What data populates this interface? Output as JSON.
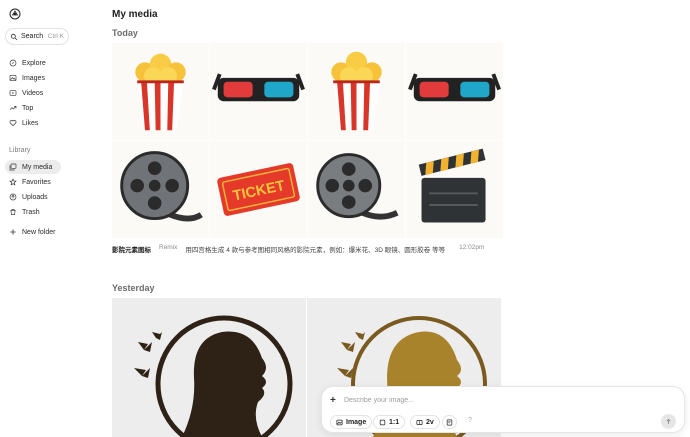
{
  "sidebar": {
    "search": {
      "label": "Search",
      "shortcut": "Ctrl K"
    },
    "nav": [
      {
        "label": "Explore",
        "icon": "compass-icon"
      },
      {
        "label": "Images",
        "icon": "image-icon"
      },
      {
        "label": "Videos",
        "icon": "video-icon"
      },
      {
        "label": "Top",
        "icon": "trending-icon"
      },
      {
        "label": "Likes",
        "icon": "heart-icon"
      }
    ],
    "library_label": "Library",
    "library": [
      {
        "label": "My media",
        "icon": "media-icon",
        "active": true
      },
      {
        "label": "Favorites",
        "icon": "star-icon"
      },
      {
        "label": "Uploads",
        "icon": "upload-icon"
      },
      {
        "label": "Trash",
        "icon": "trash-icon"
      }
    ],
    "new_folder": "New folder"
  },
  "main": {
    "title": "My media",
    "groups": [
      {
        "label": "Today",
        "images": [
          "popcorn",
          "3d-glasses",
          "popcorn",
          "3d-glasses",
          "film-reel",
          "ticket",
          "film-reel",
          "clapperboard"
        ],
        "ticket_text": "TICKET",
        "caption": {
          "title": "影院元素图标",
          "remix": "Remix",
          "prompt": "用四宫格生成 4 款与参考图相同风格的影院元素，例如：爆米花、3D 眼镜、圆形胶卷 等等",
          "time": "12:02pm"
        }
      },
      {
        "label": "Yesterday",
        "images": [
          "woman-silhouette-dark",
          "woman-silhouette-gold"
        ]
      }
    ]
  },
  "composer": {
    "placeholder": "Describe your image...",
    "mode_label": "Image",
    "ratio_label": "1:1",
    "count_label": "2v",
    "help_label": "?"
  },
  "colors": {
    "active_bg": "#ececec",
    "popcorn_red": "#d9362a",
    "gold": "#b8922a"
  }
}
